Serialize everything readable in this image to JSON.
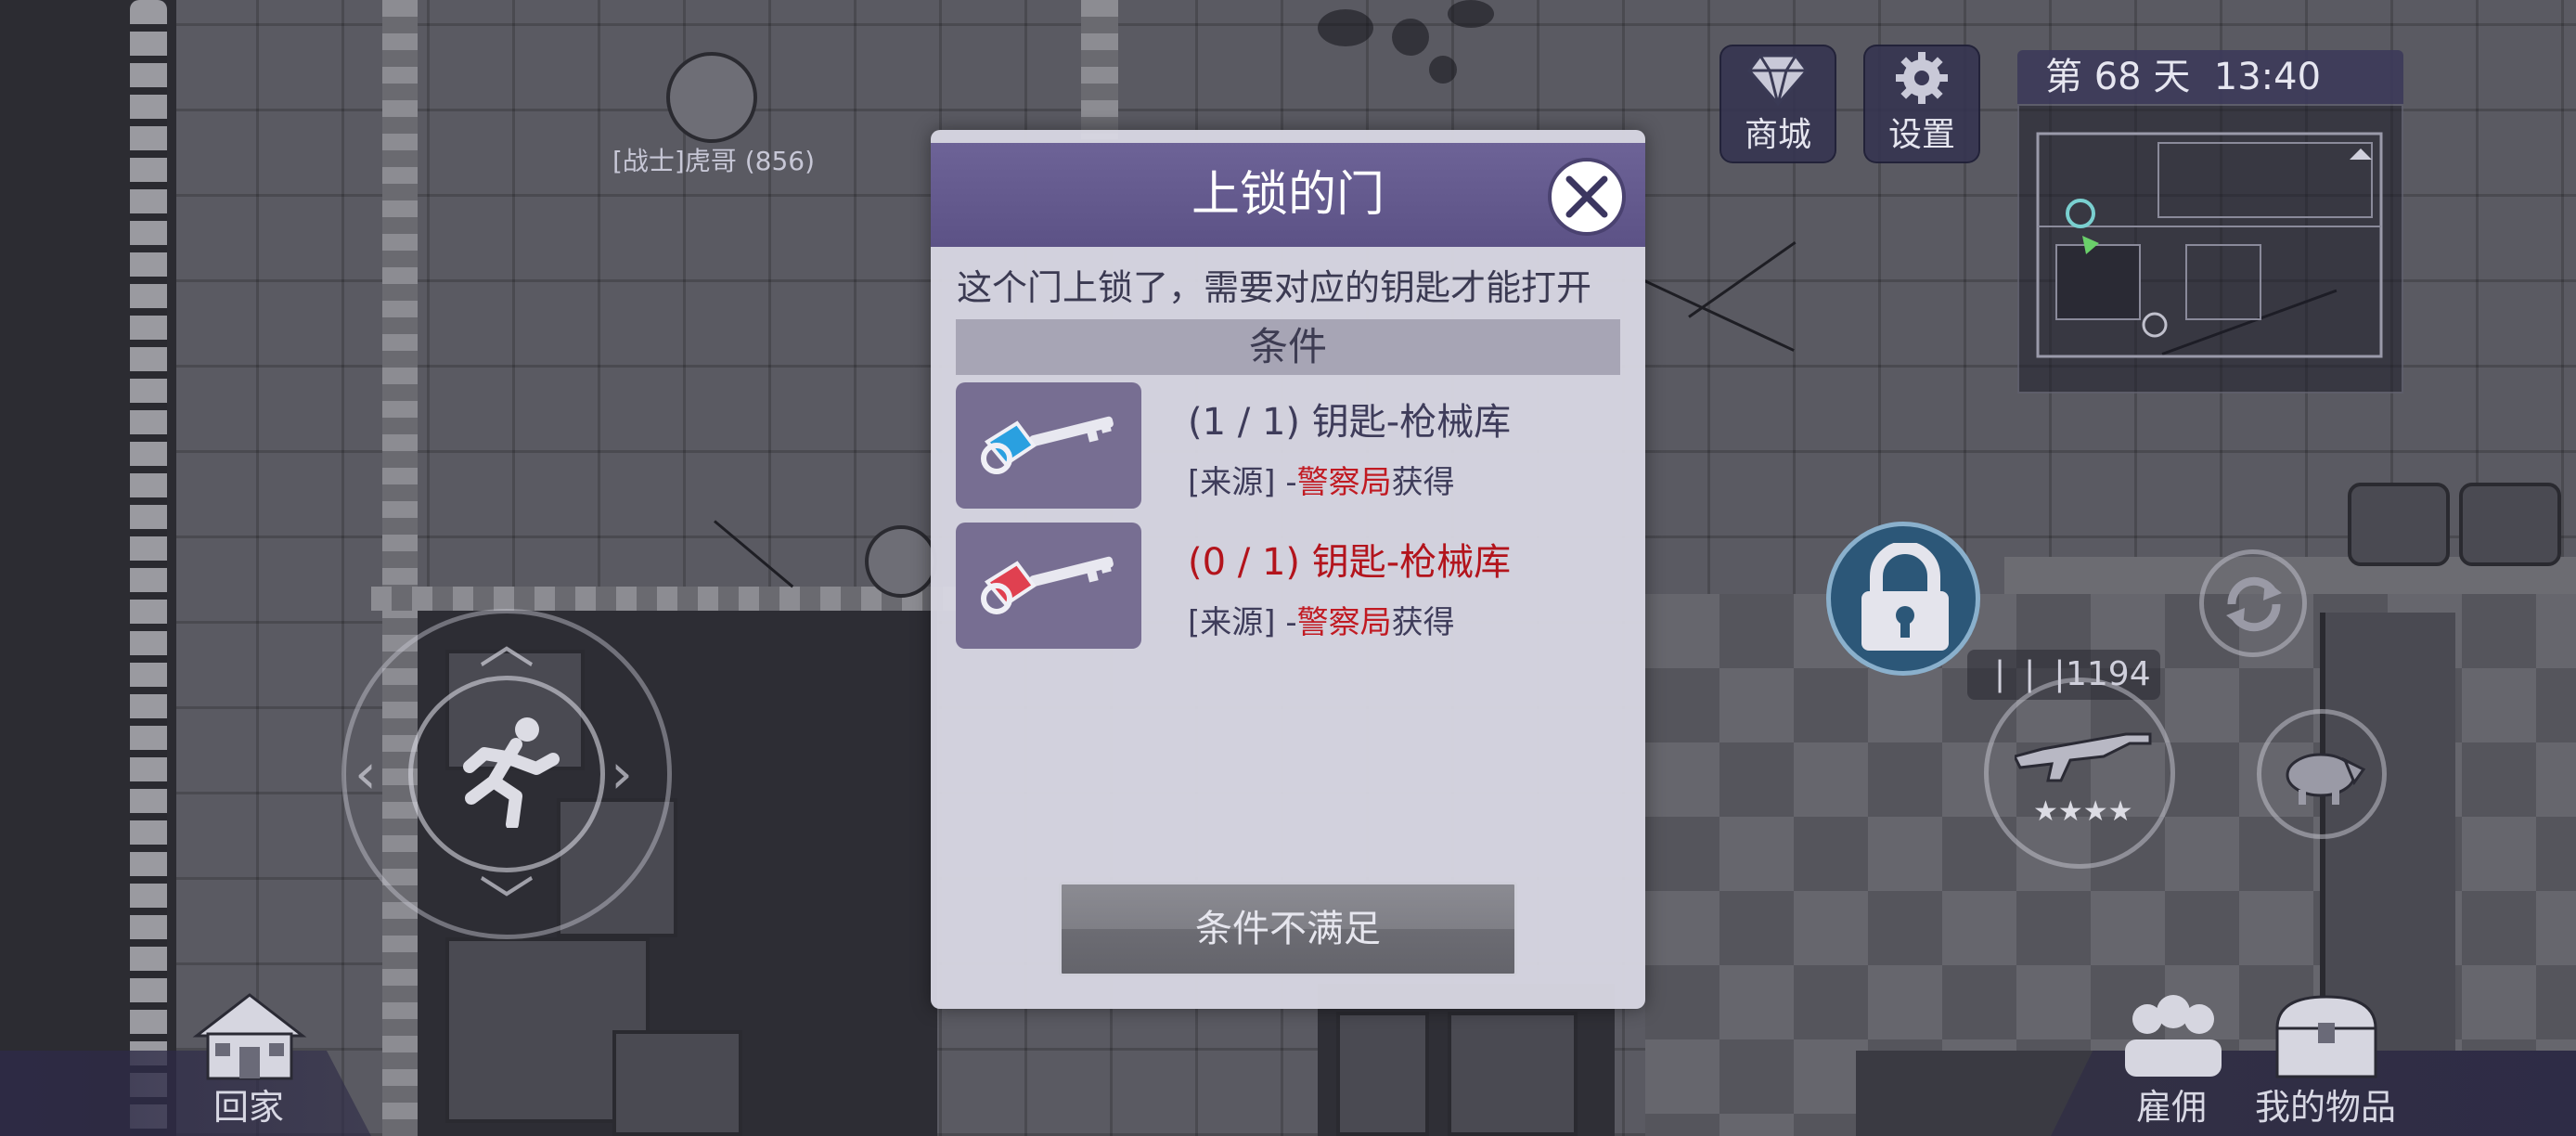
{
  "npc": {
    "name_tag": "[战士]虎哥 (856)"
  },
  "hud": {
    "shop_label": "商城",
    "settings_label": "设置",
    "day_label": "第 68 天  13:40",
    "ammo_count": "1194",
    "weapon_stars": 4,
    "home_label": "回家",
    "hire_label": "雇佣",
    "inventory_label": "我的物品"
  },
  "modal": {
    "title": "上锁的门",
    "description": "这个门上锁了，需要对应的钥匙才能打开",
    "conditions_header": "条件",
    "requirements": [
      {
        "progress": "(1 / 1) 钥匙-枪械库",
        "source_prefix": "[来源] -",
        "source_location": "警察局",
        "source_suffix": "获得",
        "met": true,
        "key_color": "#2aa0e0"
      },
      {
        "progress": "(0 / 1) 钥匙-枪械库",
        "source_prefix": "[来源] -",
        "source_location": "警察局",
        "source_suffix": "获得",
        "met": false,
        "key_color": "#e04050"
      }
    ],
    "status_button": "条件不满足"
  }
}
